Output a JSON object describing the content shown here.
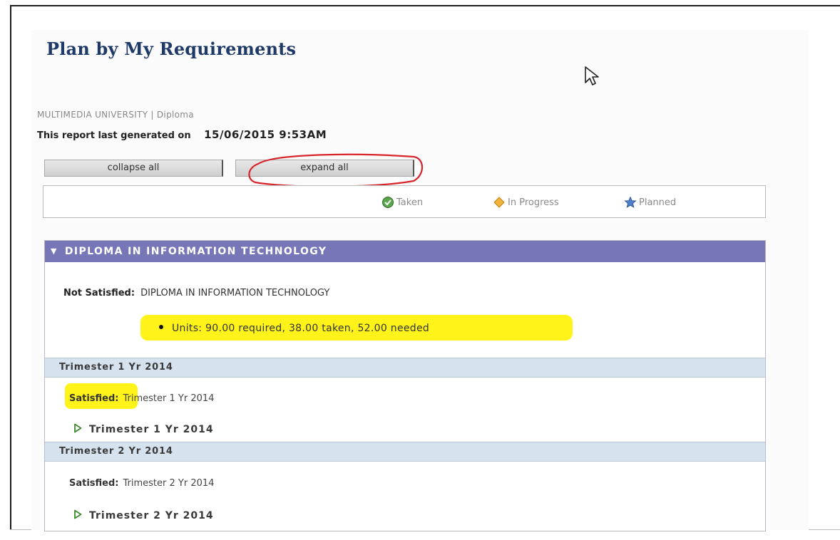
{
  "page": {
    "title": "Plan by My Requirements",
    "institution": "MULTIMEDIA UNIVERSITY | Diploma",
    "generated_label": "This report last generated on",
    "generated_date": "15/06/2015 9:53AM"
  },
  "buttons": {
    "collapse_label": "collapse all",
    "expand_label": "expand all"
  },
  "legend": {
    "taken": "Taken",
    "in_progress": "In Progress",
    "planned": "Planned"
  },
  "section": {
    "header": "DIPLOMA IN INFORMATION TECHNOLOGY",
    "status_label": "Not Satisfied:",
    "status_text": "DIPLOMA IN INFORMATION TECHNOLOGY",
    "units_text": "Units: 90.00 required, 38.00 taken, 52.00 needed",
    "terms": [
      {
        "bar": "Trimester 1 Yr 2014",
        "status_label": "Satisfied:",
        "status_text": "Trimester 1 Yr 2014",
        "link": "Trimester 1 Yr 2014"
      },
      {
        "bar": "Trimester 2 Yr 2014",
        "status_label": "Satisfied:",
        "status_text": "Trimester 2 Yr 2014",
        "link": "Trimester 2 Yr 2014"
      }
    ]
  },
  "colors": {
    "header_bg": "#7777b8",
    "term_bar_bg": "#d6e3ef",
    "highlight": "#fff200",
    "annotation_red": "#d9232a",
    "title": "#1f3a68"
  },
  "icons": [
    "check-icon",
    "diamond-icon",
    "star-icon",
    "collapse-triangle-icon",
    "expand-arrow-icon",
    "mouse-cursor-icon"
  ]
}
